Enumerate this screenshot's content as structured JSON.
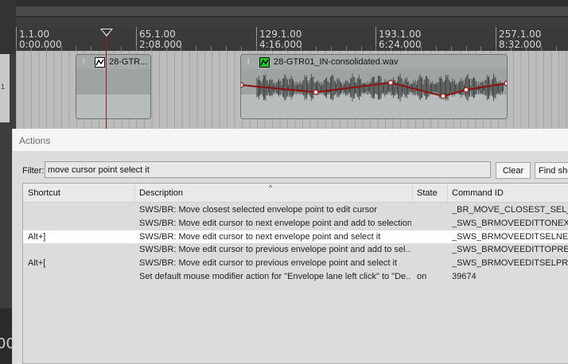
{
  "timeline": {
    "markers": [
      {
        "bar": "1.1.00",
        "time": "0:00.000"
      },
      {
        "bar": "65.1.00",
        "time": "2:08.000"
      },
      {
        "bar": "129.1.00",
        "time": "4:16.000"
      },
      {
        "bar": "193.1.00",
        "time": "6:24.000"
      },
      {
        "bar": "257.1.00",
        "time": "8:32.000"
      }
    ]
  },
  "track": {
    "left_number": "1",
    "items": [
      {
        "info": "i",
        "name": "28-GTR..."
      },
      {
        "info": "i",
        "name": "28-GTR01_IN-consolidated.wav"
      }
    ]
  },
  "actions": {
    "title": "Actions",
    "filter_label": "Filter:",
    "filter_value": "move cursor point select it",
    "clear_label": "Clear",
    "find_label": "Find shortcut",
    "sort_indicator": "^",
    "columns": {
      "shortcut": "Shortcut",
      "description": "Description",
      "state": "State",
      "command_id": "Command ID"
    },
    "rows": [
      {
        "shortcut": "",
        "description": "SWS/BR: Move closest selected envelope point to edit cursor",
        "state": "",
        "command_id": "_BR_MOVE_CLOSEST_SEL_ENV_PT"
      },
      {
        "shortcut": "",
        "description": "SWS/BR: Move edit cursor to next envelope point and add to selection",
        "state": "",
        "command_id": "_SWS_BRMOVEEDITTONEXTENVADDSEL"
      },
      {
        "shortcut": "Alt+]",
        "description": "SWS/BR: Move edit cursor to next envelope point and select it",
        "state": "",
        "command_id": "_SWS_BRMOVEEDITSELNEXTENV"
      },
      {
        "shortcut": "",
        "description": "SWS/BR: Move edit cursor to previous envelope point and add to sel...",
        "state": "",
        "command_id": "_SWS_BRMOVEEDITTOPREVENVADDSEL"
      },
      {
        "shortcut": "Alt+[",
        "description": "SWS/BR: Move edit cursor to previous envelope point and select it",
        "state": "",
        "command_id": "_SWS_BRMOVEEDITSELPREVENV"
      },
      {
        "shortcut": "",
        "description": "Set default mouse modifier action for \"Envelope lane left click\" to \"De...",
        "state": "on",
        "command_id": "39674"
      }
    ],
    "selected_row": 2
  },
  "bottom_left_text": "00",
  "colors": {
    "envelope": "#8c1010",
    "cursor": "#a01818",
    "env_button_active": "#22c42a"
  }
}
